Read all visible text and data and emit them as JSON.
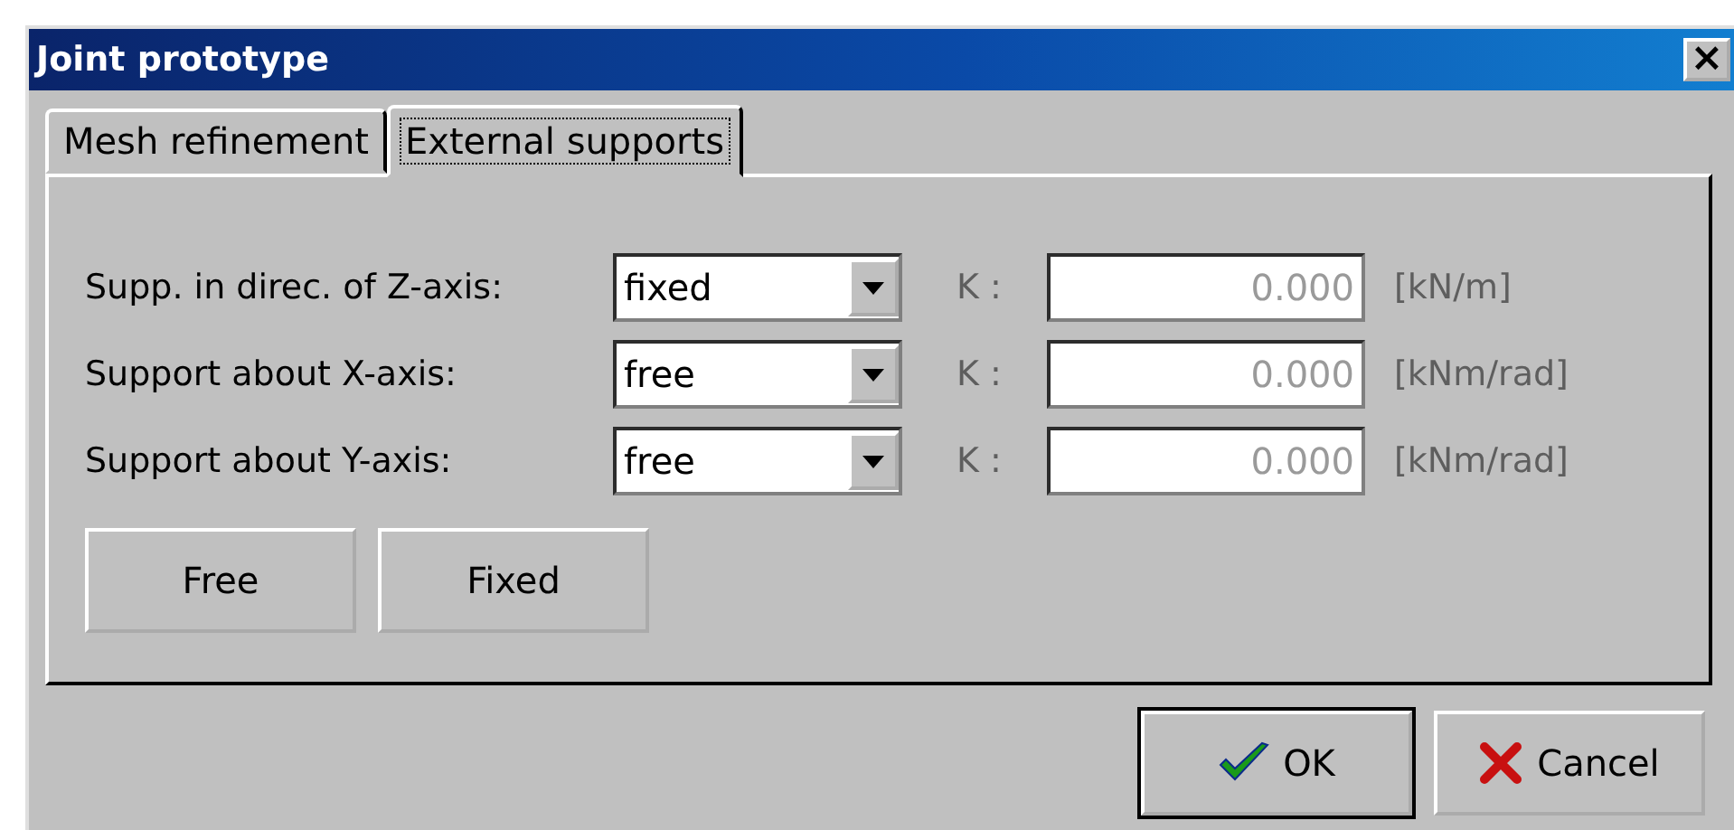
{
  "window": {
    "title": "Joint prototype",
    "close": "×"
  },
  "tabs": [
    {
      "label": "Mesh refinement",
      "selected": false
    },
    {
      "label": "External supports",
      "selected": true
    }
  ],
  "supports": [
    {
      "label": "Supp. in direc. of Z-axis:",
      "value": "fixed",
      "k_label": "K :",
      "k_value": "0.000",
      "unit": "[kN/m]",
      "disabled": true
    },
    {
      "label": "Support about X-axis:",
      "value": "free",
      "k_label": "K :",
      "k_value": "0.000",
      "unit": "[kNm/rad]",
      "disabled": true
    },
    {
      "label": "Support about Y-axis:",
      "value": "free",
      "k_label": "K :",
      "k_value": "0.000",
      "unit": "[kNm/rad]",
      "disabled": true
    }
  ],
  "preset_buttons": [
    "Free",
    "Fixed"
  ],
  "buttons": [
    {
      "label": "OK",
      "kind": "ok",
      "default": true
    },
    {
      "label": "Cancel",
      "kind": "cancel",
      "default": false
    }
  ]
}
